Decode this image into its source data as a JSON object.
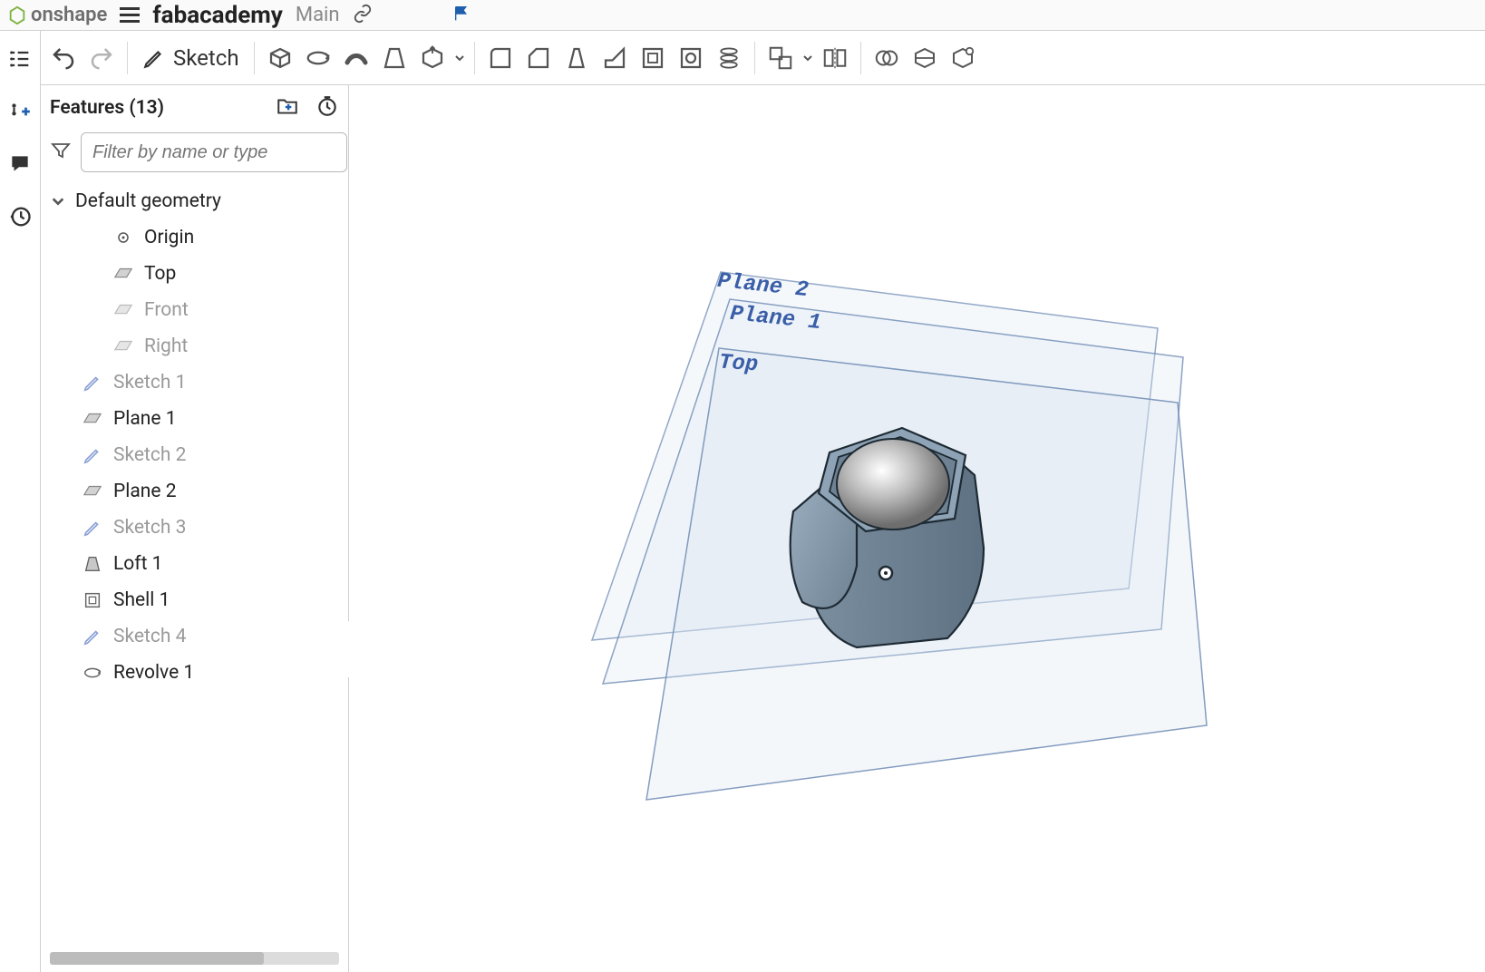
{
  "header": {
    "app_name": "onshape",
    "doc_name": "fabacademy",
    "branch": "Main"
  },
  "toolbar": {
    "sketch_label": "Sketch"
  },
  "feature_panel": {
    "title": "Features (13)",
    "filter_placeholder": "Filter by name or type",
    "default_geometry_label": "Default geometry",
    "items": {
      "origin": "Origin",
      "top": "Top",
      "front": "Front",
      "right": "Right"
    },
    "features": [
      {
        "label": "Sketch 1",
        "type": "sketch",
        "dim": true
      },
      {
        "label": "Plane 1",
        "type": "plane",
        "dim": false
      },
      {
        "label": "Sketch 2",
        "type": "sketch",
        "dim": true
      },
      {
        "label": "Plane 2",
        "type": "plane",
        "dim": false
      },
      {
        "label": "Sketch 3",
        "type": "sketch",
        "dim": true
      },
      {
        "label": "Loft 1",
        "type": "loft",
        "dim": false
      },
      {
        "label": "Shell 1",
        "type": "shell",
        "dim": false
      },
      {
        "label": "Sketch 4",
        "type": "sketch",
        "dim": true
      },
      {
        "label": "Revolve 1",
        "type": "revolve",
        "dim": false
      }
    ]
  },
  "canvas": {
    "labels": {
      "plane2": "Plane 2",
      "plane1": "Plane 1",
      "top": "Top"
    }
  }
}
